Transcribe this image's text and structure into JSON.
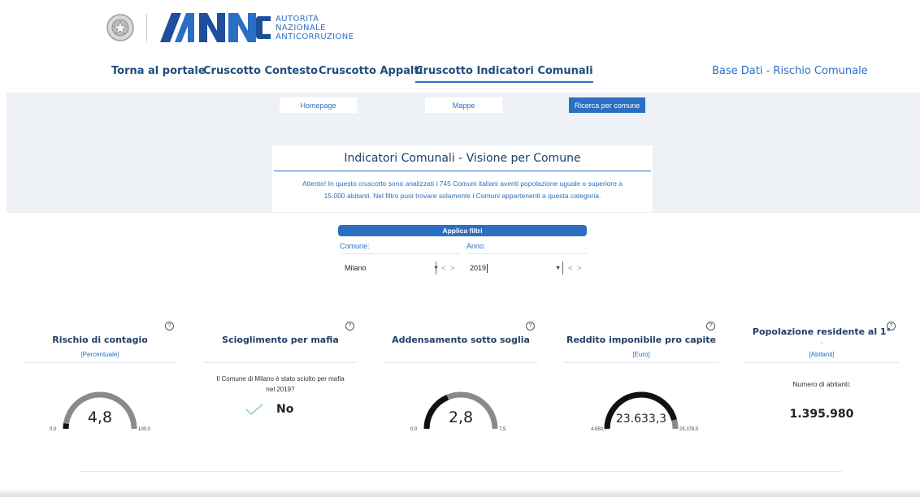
{
  "header": {
    "org_name": [
      "AUTORITÀ",
      "NAZIONALE",
      "ANTICORRUZIONE"
    ]
  },
  "topnav": {
    "items": [
      "Torna al portale",
      "Cruscotto Contesto",
      "Cruscotto Appalti",
      "Cruscotto Indicatori Comunali"
    ],
    "active_index": 3,
    "right_link": "Base Dati - Rischio Comunale"
  },
  "subtabs": {
    "items": [
      "Homepage",
      "Mappe",
      "Ricerca per comune"
    ],
    "active_index": 2
  },
  "main": {
    "title": "Indicatori Comunali - Visione per Comune",
    "notice_line1": "Attento! In questo cruscotto sono analizzati i 745 Comuni italiani aventi popolazione uguale o superiore a",
    "notice_line2": "15.000 abitanti. Nel filtro puoi trovare solamente i Comuni appartenenti a questa categoria."
  },
  "filters": {
    "apply_label": "Applica filtri",
    "comune_label": "Comune:",
    "comune_value": "Milano",
    "anno_label": "Anno:",
    "anno_value": "2019",
    "prev": "<",
    "next": ">"
  },
  "kpis": {
    "help_glyph": "?",
    "contagio": {
      "title": "Rischio di contagio",
      "unit": "[Percentuale]",
      "value": "4,8",
      "min": "0,0",
      "max": "100,0",
      "fraction": 0.048
    },
    "mafia": {
      "title": "Scioglimento per mafia",
      "question_line1": "Il Comune di Milano è stato sciolto per mafia",
      "question_line2": "nel 2019?",
      "answer": "No"
    },
    "addensamento": {
      "title": "Addensamento sotto soglia",
      "value": "2,8",
      "min": "0,0",
      "max": "7,5",
      "fraction": 0.373
    },
    "reddito": {
      "title": "Reddito imponibile pro capite",
      "unit": "[Euro]",
      "value": "23.633,3",
      "min": "4.650,7",
      "max": "25.378,5",
      "fraction": 0.916
    },
    "popolazione": {
      "title": "Popolazione residente al 1°",
      "sub": "-",
      "unit": "[Abitanti]",
      "label": "Numero di abitanti:",
      "value": "1.395.980"
    }
  },
  "colors": {
    "accent": "#2a6fc4",
    "gauge_fill": "#111111",
    "gauge_track": "#8a8a8a"
  }
}
